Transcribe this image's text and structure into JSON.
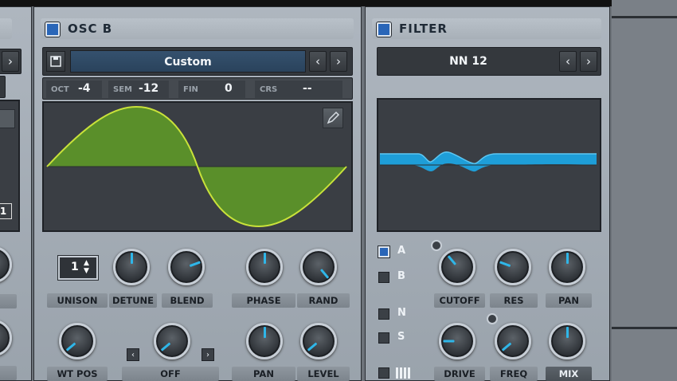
{
  "osc_b": {
    "title": "OSC B",
    "wavetable_name": "Custom",
    "oct_label": "OCT",
    "oct_value": "-4",
    "sem_label": "SEM",
    "sem_value": "-12",
    "fin_label": "FIN",
    "fin_value": "0",
    "crs_label": "CRS",
    "crs_value": "--",
    "unison_value": "1",
    "knob_labels": {
      "unison": "UNISON",
      "detune": "DETUNE",
      "blend": "BLEND",
      "phase": "PHASE",
      "rand": "RAND",
      "wt_pos": "WT POS",
      "warp": "OFF",
      "pan": "PAN",
      "level": "LEVEL"
    }
  },
  "filter": {
    "title": "FILTER",
    "type": "NN 12",
    "route_a": "A",
    "route_b": "B",
    "route_n": "N",
    "route_s": "S",
    "knob_labels": {
      "cutoff": "CUTOFF",
      "res": "RES",
      "pan": "PAN",
      "drive": "DRIVE",
      "freq": "FREQ",
      "mix": "MIX"
    }
  },
  "left_panel": {
    "value_box": "1"
  },
  "icons": {
    "prev": "‹",
    "next": "›"
  },
  "colors": {
    "accent": "#2fb6e8",
    "wave_fill": "#5a8f2a",
    "wave_line": "#c9e23a",
    "filter_curve": "#1e9ed8"
  }
}
